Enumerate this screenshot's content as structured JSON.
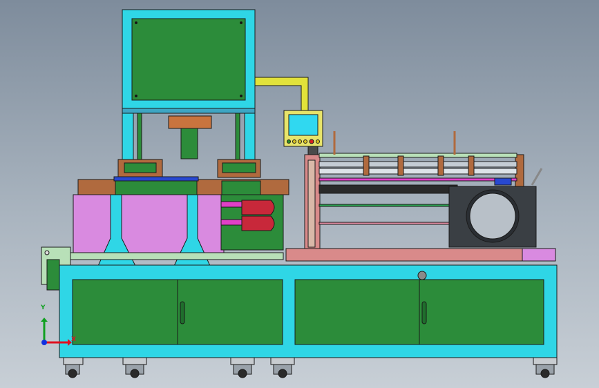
{
  "scene": {
    "type": "cad-assembly-front-view",
    "background_top": "#7e8c9c",
    "background_bottom": "#c8cfd6"
  },
  "colors": {
    "frame": "#2fd6e6",
    "panel": "#2c8c3a",
    "panel_dark": "#1f6e2c",
    "press_block": "#d98ae0",
    "copper": "#b06a3e",
    "yellow_duct": "#e2e23a",
    "salmon_bed": "#d98a8a",
    "motor": "#3a3f44",
    "red_clamp": "#c8283a",
    "roller": "#c4ccd4",
    "outline": "#1a1a1a"
  },
  "axes": {
    "x": "X",
    "y": "Y",
    "x_color": "#e01020",
    "y_color": "#10a020",
    "z_color": "#1030e0"
  },
  "components": [
    "upper-frame",
    "control-panel-screen",
    "press-head",
    "cabinet-doors",
    "unwind-roller-unit",
    "motor-drum",
    "caster-wheels"
  ]
}
